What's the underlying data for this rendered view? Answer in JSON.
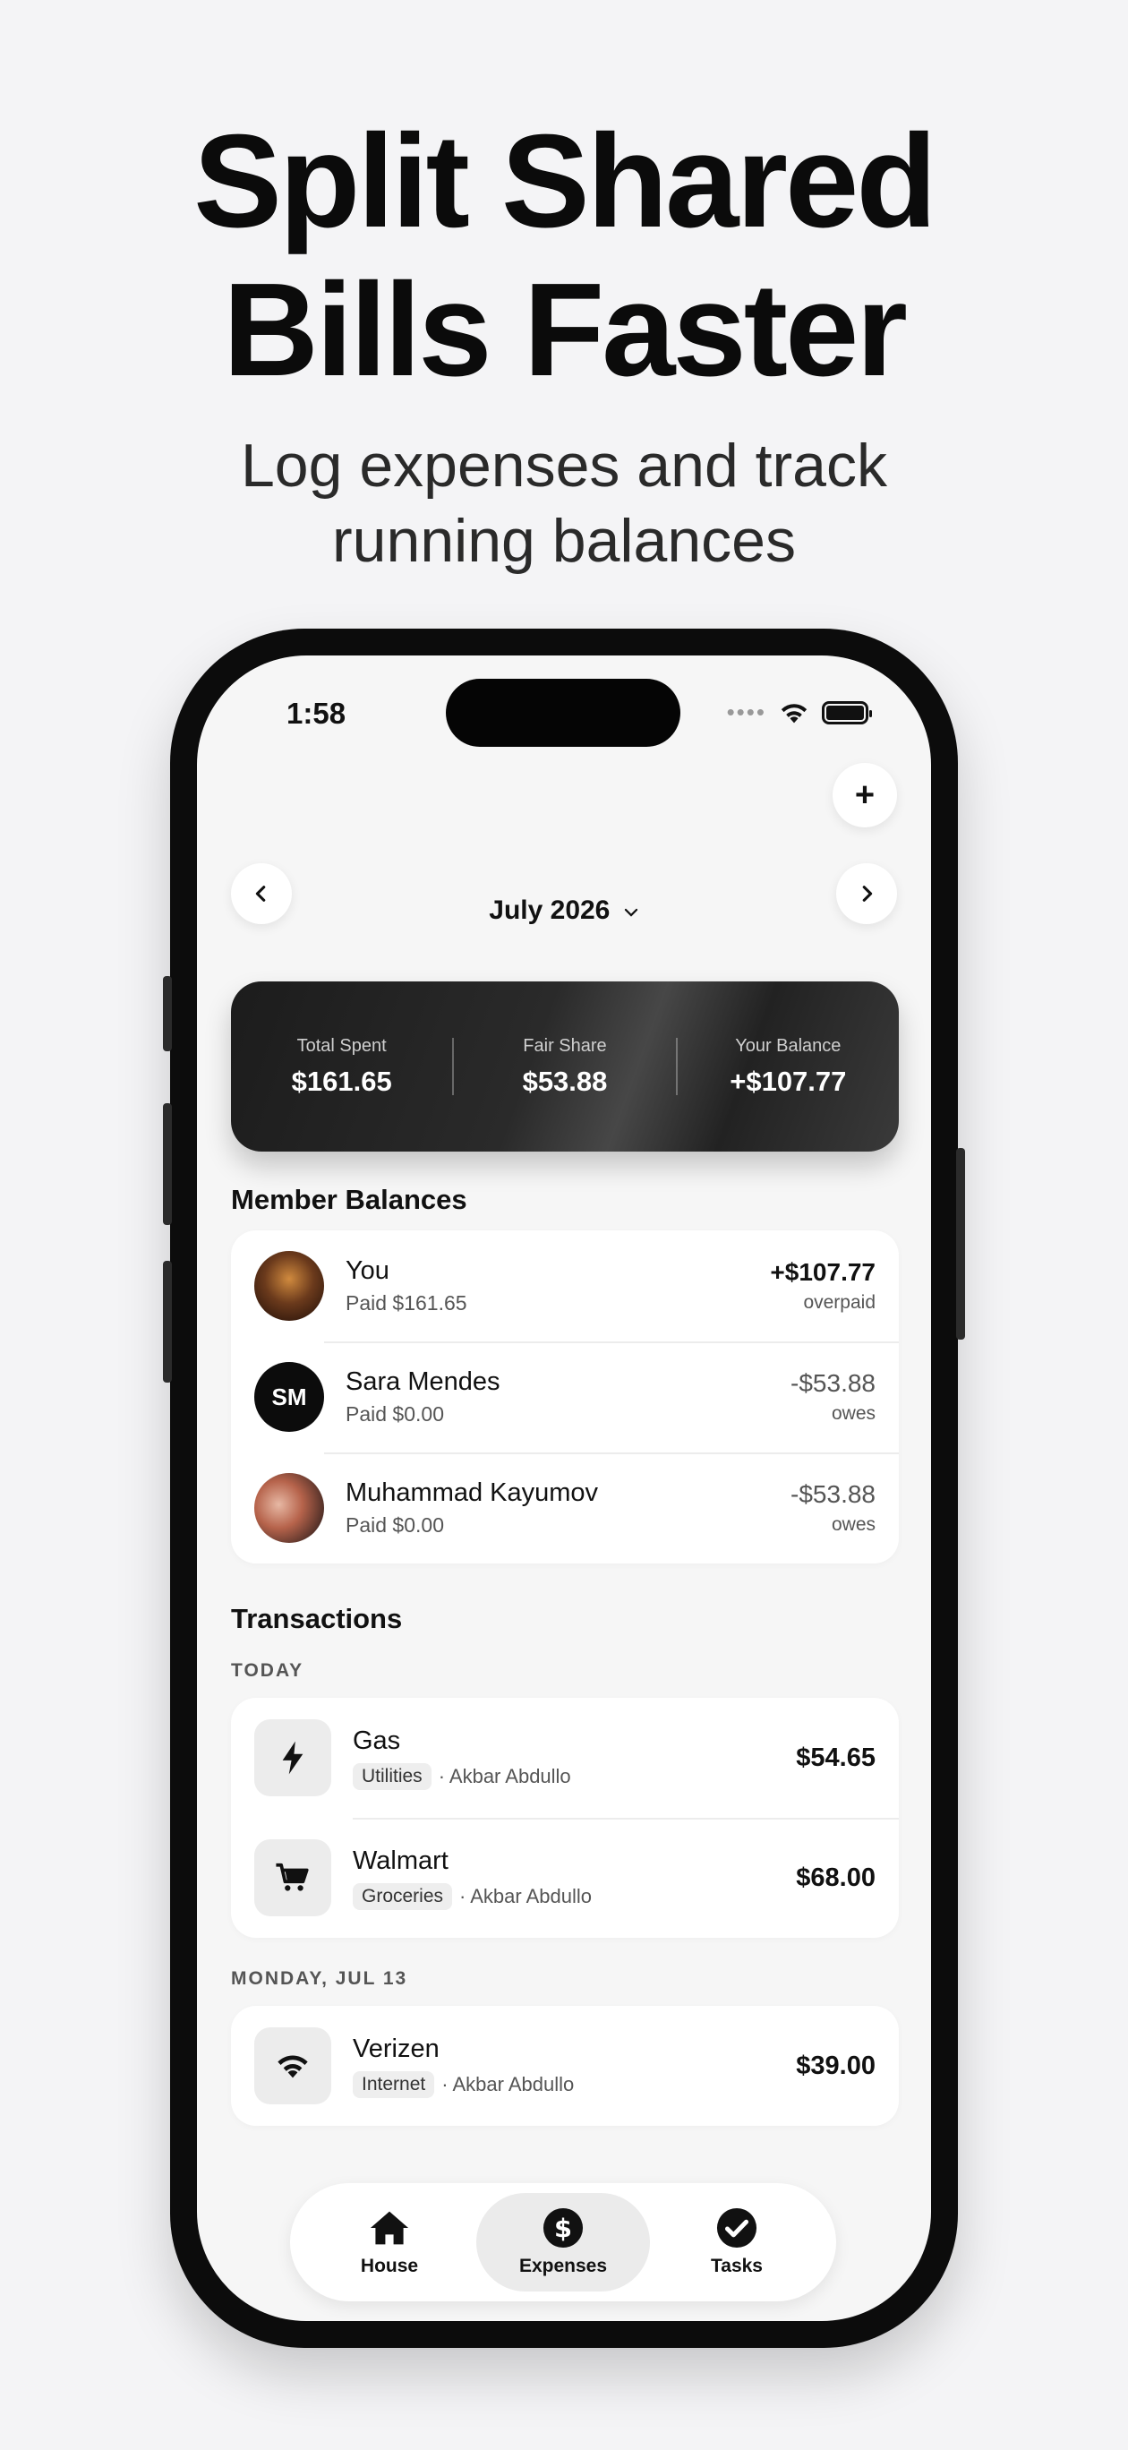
{
  "headline": [
    "Split Shared",
    "Bills Faster"
  ],
  "subheadline": [
    "Log expenses and track",
    "running balances"
  ],
  "status_bar": {
    "time": "1:58"
  },
  "header": {
    "month": "July 2026"
  },
  "summary": {
    "total_spent_label": "Total Spent",
    "total_spent": "$161.65",
    "fair_share_label": "Fair Share",
    "fair_share": "$53.88",
    "your_balance_label": "Your Balance",
    "your_balance": "+$107.77"
  },
  "member_balances": {
    "title": "Member Balances",
    "members": [
      {
        "name": "You",
        "paid": "Paid $161.65",
        "amount": "+$107.77",
        "status": "overpaid"
      },
      {
        "name": "Sara Mendes",
        "initials": "SM",
        "paid": "Paid $0.00",
        "amount": "-$53.88",
        "status": "owes"
      },
      {
        "name": "Muhammad Kayumov",
        "paid": "Paid $0.00",
        "amount": "-$53.88",
        "status": "owes"
      }
    ]
  },
  "transactions": {
    "title": "Transactions",
    "groups": [
      {
        "label": "TODAY",
        "items": [
          {
            "name": "Gas",
            "category": "Utilities",
            "payer": "· Akbar Abdullo",
            "amount": "$54.65",
            "icon": "bolt-icon"
          },
          {
            "name": "Walmart",
            "category": "Groceries",
            "payer": "· Akbar Abdullo",
            "amount": "$68.00",
            "icon": "cart-icon"
          }
        ]
      },
      {
        "label": "MONDAY, JUL 13",
        "items": [
          {
            "name": "Verizen",
            "category": "Internet",
            "payer": "· Akbar Abdullo",
            "amount": "$39.00",
            "icon": "wifi-icon"
          }
        ]
      }
    ]
  },
  "tabbar": {
    "tabs": [
      {
        "label": "House",
        "icon": "house-icon"
      },
      {
        "label": "Expenses",
        "icon": "dollar-icon",
        "active": true
      },
      {
        "label": "Tasks",
        "icon": "check-icon"
      }
    ]
  }
}
